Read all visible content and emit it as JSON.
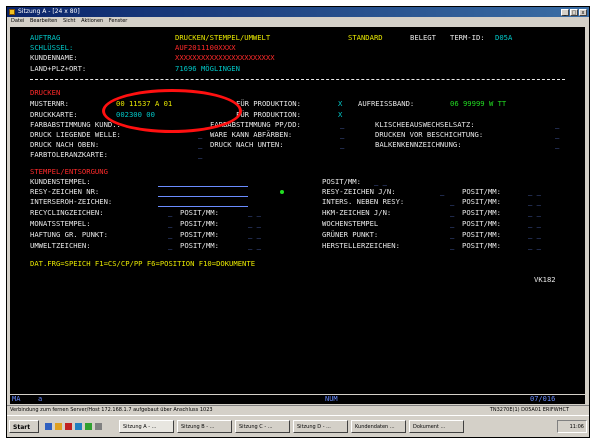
{
  "window": {
    "title": "Sitzung A - [24 x 80]",
    "controls": [
      "_",
      "□",
      "x"
    ]
  },
  "menu": [
    "Datei",
    "Bearbeiten",
    "Sicht",
    "Aktionen",
    "Fenster"
  ],
  "header": {
    "auftrag_label": "AUFTRAG",
    "screen_title": "DRUCKEN/STEMPEL/UMWELT",
    "mode": "STANDARD",
    "belegt_label": "BELEGT",
    "termid_label": "TERM-ID:",
    "termid_value": "D05A",
    "schluessel_label": "SCHLÜSSEL:",
    "schluessel_value": "AUF2011100XXXX",
    "kundenname_label": "KUNDENNAME:",
    "kundenname_value": "XXXXXXXXXXXXXXXXXXXXXXX",
    "land_label": "LAND+PLZ+ORT:",
    "land_value": "71696 MÖGLINGEN",
    "separator": "----------------------------------------------------------------------"
  },
  "drucken": {
    "section_label": "DRUCKEN",
    "musternr_label": "MUSTERNR:",
    "musternr_value": "00 11537 A 01",
    "fuer_produktion_label_1": "FÜR PRODUKTION:",
    "fuer_produktion_value_1": "X",
    "aufreissband_label": "AUFREISSBAND:",
    "aufreissband_value": "06 99999 W TT",
    "druckkarte_label": "DRUCKKARTE:",
    "druckkarte_value": "002300 00",
    "fuer_produktion_label_2": "FÜR PRODUKTION:",
    "fuer_produktion_value_2": "X",
    "farbabstimmung_kunde_label": "FARBABSTIMMUNG KUND.:",
    "farbabstimmung_ppdd_label": "FARBABSTIMMUNG PP/DD:",
    "klischee_label": "KLISCHEEAUSWECHSELSATZ:",
    "druck_liegende_welle_label": "DRUCK LIEGENDE WELLE:",
    "ware_kann_label": "WARE KANN ABFÄRBEN:",
    "drucken_vor_label": "DRUCKEN VOR BESCHICHTUNG:",
    "druck_oben_label": "DRUCK NACH OBEN:",
    "druck_unten_label": "DRUCK NACH UNTEN:",
    "balken_label": "BALKENKENNZEICHNUNG:",
    "farbtoleranz_label": "FARBTOLERANZKARTE:"
  },
  "stempel": {
    "section_label": "STEMPEL/ENTSORGUNG",
    "kundenstempel_label": "KUNDENSTEMPEL:",
    "posit_mm_label": "POSIT/MM:",
    "resy_nr_label": "RESY-ZEICHEN NR:",
    "resy_jn_label": "RESY-ZEICHEN J/N:",
    "interseroh_label": "INTERSEROH-ZEICHEN:",
    "inters_neben_label": "INTERS. NEBEN RESY:",
    "recycling_label": "RECYCLINGZEICHEN:",
    "hkm_label": "HKM-ZEICHEN J/N:",
    "monats_label": "MONATSSTEMPEL:",
    "wochen_label": "WOCHENSTEMPEL",
    "haftung_label": "HAFTUNG GR. PUNKT:",
    "gruener_label": "GRÜNER PUNKT:",
    "umwelt_label": "UMWELTZEICHEN:",
    "hersteller_label": "HERSTELLERZEICHEN:"
  },
  "footer": {
    "fkeys": "DAT.FRG=SPEICH F1=CS/CP/PP F6=POSITION F10=DOKUMENTE",
    "screen_id": "VK182"
  },
  "oia": {
    "left": "MA",
    "session": "a",
    "num": "NUM",
    "cursor": "07/016"
  },
  "statusbar": {
    "left": "Verbindung zum fernen Server/Host 172.168.1.7 aufgebaut über Anschluss 1023",
    "right": "TN3270E(1) D05A01 ERIFWHCT"
  },
  "taskbar": {
    "start": "Start",
    "tasks": [
      "Sitzung A - ...",
      "Sitzung B - ...",
      "Sitzung C - ...",
      "Sitzung D - ...",
      "Kundendaten ...",
      "Dokument ..."
    ],
    "clock": "11:06"
  },
  "colors": {
    "screen_bg": "#000000",
    "cyan": "#00c8c8",
    "yellow": "#e8e800",
    "green": "#22dd22",
    "red": "#ff2a2a",
    "highlight_circle": "#ff1010"
  }
}
